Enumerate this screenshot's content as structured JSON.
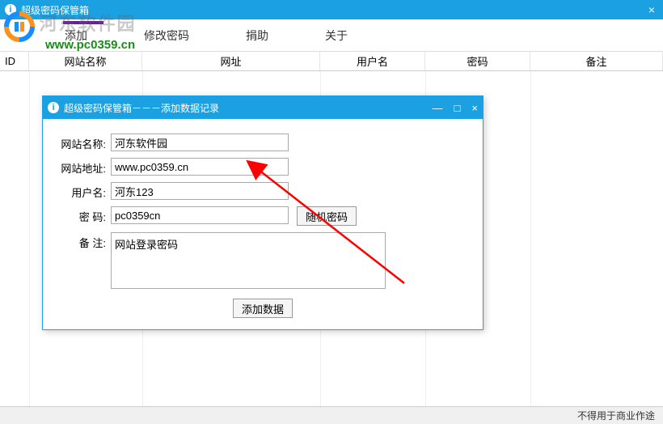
{
  "app": {
    "title": "超级密码保管箱",
    "close": "×"
  },
  "menu": {
    "add": "添加",
    "change_pw": "修改密码",
    "donate": "捐助",
    "about": "关于"
  },
  "watermark": {
    "text1": "河东软件园",
    "text2": "www.pc0359.cn"
  },
  "columns": {
    "id": "ID",
    "name": "网站名称",
    "url": "网址",
    "user": "用户名",
    "pass": "密码",
    "note": "备注"
  },
  "dialog": {
    "title": "超级密码保管箱－－－添加数据记录",
    "min": "—",
    "max": "□",
    "close": "×",
    "labels": {
      "name": "网站名称:",
      "url": "网站地址:",
      "user": "用户名:",
      "pass": "密  码:",
      "note": "备  注:"
    },
    "values": {
      "name": "河东软件园",
      "url": "www.pc0359.cn",
      "user": "河东123",
      "pass": "pc0359cn",
      "note": "网站登录密码"
    },
    "random_btn": "随机密码",
    "add_btn": "添加数据"
  },
  "status": "不得用于商业作途"
}
